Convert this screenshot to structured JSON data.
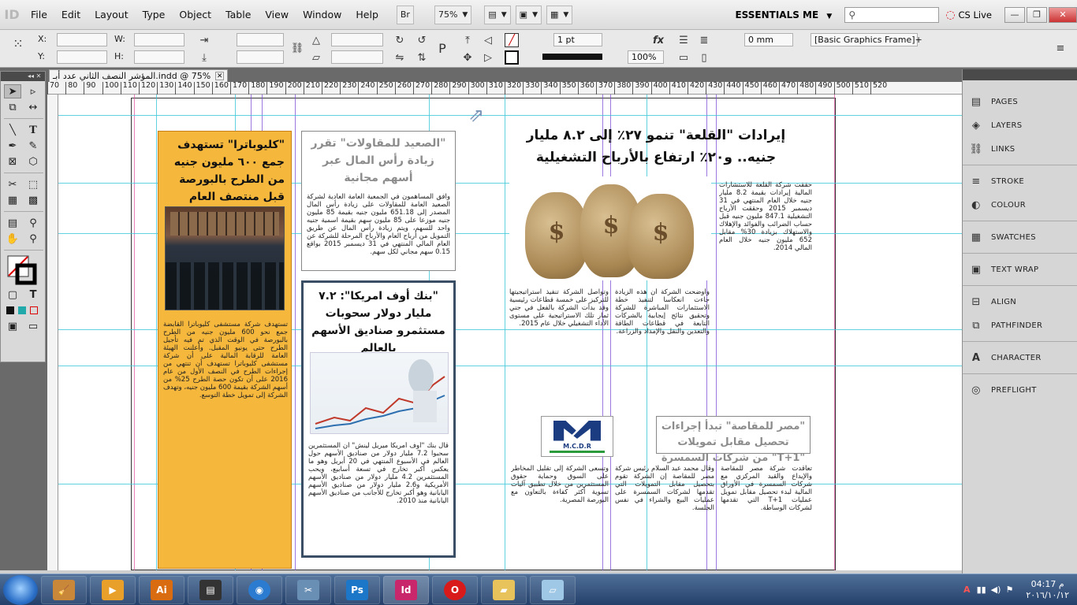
{
  "app": {
    "logo": "ID",
    "menus": [
      "File",
      "Edit",
      "Layout",
      "Type",
      "Object",
      "Table",
      "View",
      "Window",
      "Help"
    ],
    "bridge_label": "Br",
    "zoom": "75%",
    "workspace": "ESSENTIALS ME",
    "cs_live": "CS Live"
  },
  "control_panel": {
    "x_label": "X:",
    "y_label": "Y:",
    "w_label": "W:",
    "h_label": "H:",
    "stroke_weight": "1 pt",
    "opacity": "100%",
    "offset": "0 mm",
    "object_style": "[Basic Graphics Frame]+"
  },
  "document_tab": {
    "title": "المؤشر النصف الثاني عدد أبـ.indd @ 75%"
  },
  "ruler": {
    "marks": [
      "70",
      "80",
      "90",
      "100",
      "110",
      "120",
      "130",
      "140",
      "150",
      "160",
      "170",
      "180",
      "190",
      "200",
      "210",
      "220",
      "230",
      "240",
      "250",
      "260",
      "270",
      "280",
      "290",
      "300",
      "310",
      "320",
      "330",
      "340",
      "350",
      "360",
      "370",
      "380",
      "390",
      "400",
      "410",
      "420",
      "430",
      "440",
      "450",
      "460",
      "470",
      "480",
      "490",
      "500",
      "510",
      "520"
    ]
  },
  "page": {
    "left_column": {
      "headline": "\"كليوباترا\" تستهدف جمع ٦٠٠ مليون جنيه من الطرح بالبورصة قبل منتصف العام",
      "body": "تستهدف شركة مستشفى كليوباترا القابضة جمع نحو 600 مليون جنيه من الطرح بالبورصة في الوقت الذي تم فيه تأجيل الطرح حتى يونيو المقبل. وأعلنت الهيئة العامة للرقابة المالية على أن شركة مستشفى كليوباترا تستهدف أن تنتهي من إجراءات الطرح في النصف الأول من عام 2016 على أن تكون حصة الطرح 25% من أسهم الشركة بقيمة 600 مليون جنيه، وتهدف الشركة إلى تمويل خطة التوسع."
    },
    "middle_top": {
      "headline": "\"الصعيد للمقاولات\" تقرر زيادة رأس المال عبر أسهم مجانية",
      "body": "وافق المساهمون في الجمعية العامة العادية لشركة الصعيد العامة للمقاولات على زيادة رأس المال المصدر إلى 651.18 مليون جنيه بقيمة 85 مليون جنيه موزعا على 85 مليون سهم بقيمة اسمية جنيه واحد للسهم، ويتم زيادة رأس المال عن طريق التمويل من أرباح العام والأرباح المرحلة للشركة عن العام المالي المنتهي في 31 ديسمبر 2015 بواقع 0.15 سهم مجاني لكل سهم."
    },
    "middle_bottom": {
      "headline": "\"بنك أوف امريكا\": ٧.٢ مليار دولار سحوبات مستثمرو صناديق الأسهم بالعالم",
      "body": "قال بنك \"أوف أمريكا ميريل لينش\" أن المستثمرين سحبوا 7.2 مليار دولار من صناديق الأسهم حول العالم في الأسبوع المنتهي في 20 أبريل وهو ما يعكس أكبر تخارج في تسعة أسابيع، ويحب المستثمرين 4.2 مليار دولار من صناديق الأسهم الأمريكية و2.6 مليار دولار من صناديق الأسهم اليابانية وهو أكبر تخارج للأجانب من صناديق الأسهم اليابانية منذ 2010."
    },
    "right_top": {
      "headline": "إيرادات \"القلعة\" تنمو ٢٧٪ إلى ٨.٢ مليار جنيه.. و٢٠٪ ارتفاع بالأرباح التشغيلية",
      "col1": "حققت شركة القلعة للاستشارات المالية إيرادات بقيمة 8.2 مليار جنيه خلال العام المنتهي في 31 ديسمبر 2015 وحققت الأرباح التشغيلية 847.1 مليون جنيه قبل حساب الضرائب والفوائد والإهلاك والاستهلاك بزيادة 30% مقابل 652 مليون جنيه خلال العام المالي 2014.",
      "col2": "وأوضحت الشركة أن هذه الزيادة جاءت انعكاسا لتنفيذ خطة الاستثمارات المباشرة للشركة وتحقيق نتائج إيجابية بالشركات التابعة في قطاعات الطاقة والتعدين والنقل والإمداد والزراعة.",
      "col3": "وتواصل الشركة تنفيذ استراتيجيتها للتركيز على خمسة قطاعات رئيسية وقد بدأت الشركة بالفعل في جني ثمار تلك الاستراتيجية على مستوى الأداء التشغيلي خلال عام 2015."
    },
    "right_bottom": {
      "headline": "\"مصر للمقاصة\" تبدأ إجراءات تحصيل مقابل تمويلات \"T+1\" من شركات السمسرة",
      "logo_text": "M.C.D.R",
      "col1": "تعاقدت شركة مصر للمقاصة والإيداع والقيد المركزي مع شركات السمسرة في الأوراق المالية لبدء تحصيل مقابل تمويل عمليات T+1 التي تقدمها لشركات الوساطة.",
      "col2": "وقال محمد عبد السلام رئيس شركة مصر للمقاصة إن الشركة تقوم بتحصيل مقابل التمويلات التي تقدمها لشركات السمسرة على عمليات البيع والشراء في نفس الجلسة.",
      "col3": "وتسعى الشركة إلى تقليل المخاطر على السوق وحماية حقوق المستثمرين من خلال تطبيق آليات تسوية أكثر كفاءة بالتعاون مع البورصة المصرية."
    }
  },
  "right_dock": {
    "items": [
      "PAGES",
      "LAYERS",
      "LINKS",
      "STROKE",
      "COLOUR",
      "SWATCHES",
      "TEXT WRAP",
      "ALIGN",
      "PATHFINDER",
      "CHARACTER",
      "PREFLIGHT"
    ]
  },
  "taskbar": {
    "apps": [
      "Ai",
      "Ps",
      "Id"
    ],
    "time": "04:17 م",
    "date": "٢٠١٦/١٠/١٢"
  },
  "colors": {
    "orange_bg": "#f5b73c",
    "guide_cyan": "#3cc7d8",
    "guide_purple": "#7a4bd4",
    "guide_magenta": "#e04b9e",
    "ai_orange": "#d96b10",
    "ps_blue": "#1c77c8",
    "id_pink": "#c8286b"
  }
}
